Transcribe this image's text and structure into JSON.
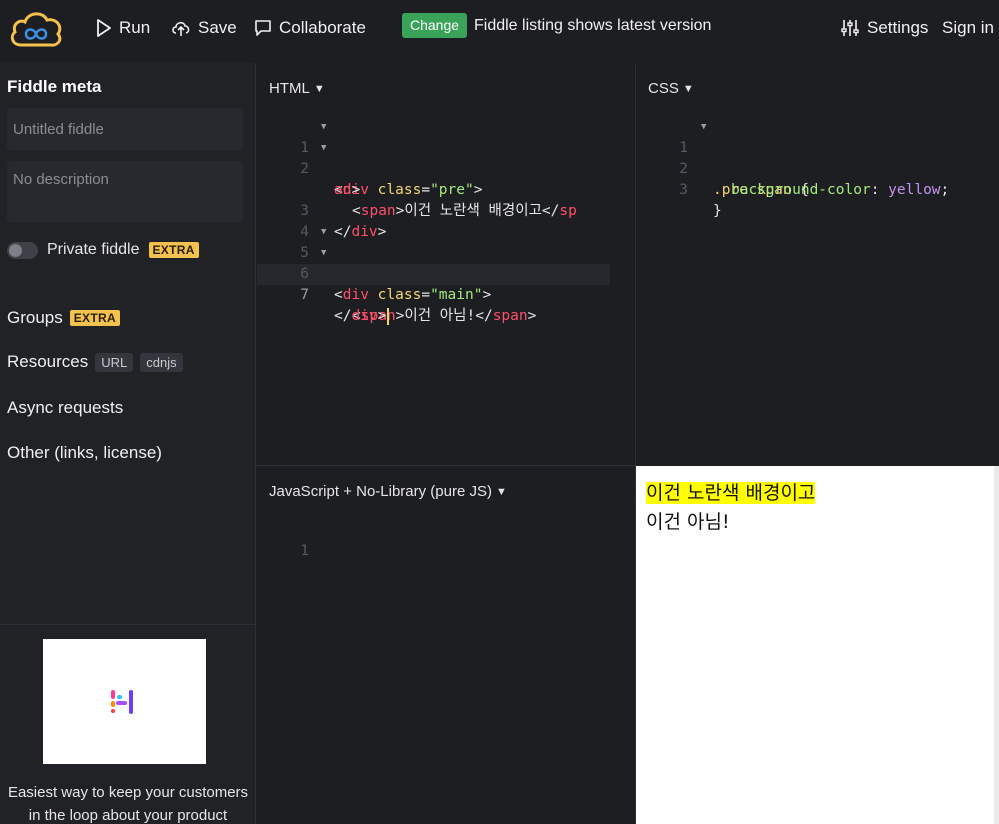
{
  "topbar": {
    "run_label": "Run",
    "save_label": "Save",
    "collaborate_label": "Collaborate",
    "change_badge": "Change",
    "change_text": "Fiddle listing shows latest version",
    "settings_label": "Settings",
    "signin_label": "Sign in",
    "icons": [
      "logo-cloud-icon",
      "play-icon",
      "upload-icon",
      "chat-icon",
      "sliders-icon"
    ]
  },
  "sidebar": {
    "title": "Fiddle meta",
    "title_placeholder": "Untitled fiddle",
    "description_placeholder": "No description",
    "private_label": "Private fiddle",
    "extra_badge": "EXTRA",
    "groups_label": "Groups",
    "groups_badge": "EXTRA",
    "resources_label": "Resources",
    "resources_chips": [
      "URL",
      "cdnjs"
    ],
    "async_label": "Async requests",
    "other_label": "Other (links, license)",
    "ad_text_1": "Easiest way to keep your customers",
    "ad_text_2": "in the loop about your product"
  },
  "html_panel": {
    "label": "HTML",
    "lines": [
      {
        "n": "1",
        "fold": true
      },
      {
        "n": "2",
        "fold": true
      },
      {
        "n": "",
        "fold": false
      },
      {
        "n": "3",
        "fold": false
      },
      {
        "n": "4",
        "fold": false
      },
      {
        "n": "5",
        "fold": true
      },
      {
        "n": "6",
        "fold": true
      },
      {
        "n": "7",
        "fold": false
      }
    ],
    "code": {
      "l1_tag": "div",
      "l1_attr": "class",
      "l1_val": "\"pre\"",
      "l2_tag": "span",
      "l2_text": "이건 노란색 배경이고",
      "l2_close_a": "sp",
      "l2_close_b": "an",
      "l3_tag": "div",
      "l5_tag": "div",
      "l5_attr": "class",
      "l5_val": "\"main\"",
      "l6_tag": "span",
      "l6_text": "이건 아님!",
      "l6_close": "span",
      "l7_tag": "div"
    }
  },
  "css_panel": {
    "label": "CSS",
    "line_numbers": [
      "1",
      "2",
      "3"
    ],
    "code": {
      "selector_a": ".pre",
      "selector_b": "span",
      "property": "background-color",
      "value": "yellow"
    }
  },
  "js_panel": {
    "label": "JavaScript + No-Library (pure JS)",
    "line_numbers": [
      "1"
    ]
  },
  "result": {
    "line1": "이건 노란색 배경이고",
    "line2": "이건 아님!",
    "highlight_color": "#ffff00"
  }
}
